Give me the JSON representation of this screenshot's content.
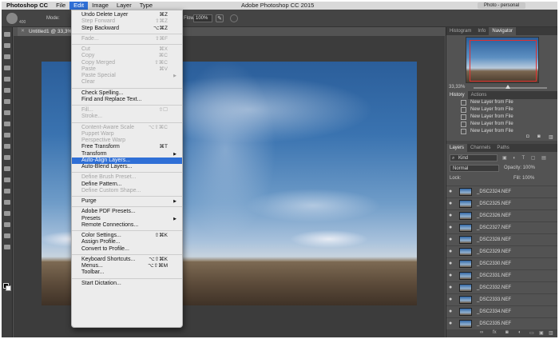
{
  "menubar": {
    "app_name": "Photoshop CC",
    "menus": [
      "File",
      "Edit",
      "Image",
      "Layer",
      "Type"
    ],
    "window_title": "Adobe Photoshop CC 2015",
    "workspace": "Photo - personal"
  },
  "options": {
    "brush_size": "400",
    "mode_label": "Mode:",
    "flow_label": "Flow:",
    "flow_value": "100%"
  },
  "document": {
    "tab_title": "Untitled1 @ 33,3% (RGB/8) *"
  },
  "edit_menu": {
    "items": [
      {
        "label": "Undo Delete Layer",
        "shortcut": "⌘Z",
        "disabled": false
      },
      {
        "label": "Step Forward",
        "shortcut": "⇧⌘Z",
        "disabled": true
      },
      {
        "label": "Step Backward",
        "shortcut": "⌥⌘Z",
        "disabled": false
      },
      {
        "sep": true
      },
      {
        "label": "Fade...",
        "shortcut": "⇧⌘F",
        "disabled": true
      },
      {
        "sep": true
      },
      {
        "label": "Cut",
        "shortcut": "⌘X",
        "disabled": true
      },
      {
        "label": "Copy",
        "shortcut": "⌘C",
        "disabled": true
      },
      {
        "label": "Copy Merged",
        "shortcut": "⇧⌘C",
        "disabled": true
      },
      {
        "label": "Paste",
        "shortcut": "⌘V",
        "disabled": true
      },
      {
        "label": "Paste Special",
        "arrow": true,
        "disabled": true
      },
      {
        "label": "Clear",
        "disabled": true
      },
      {
        "sep": true
      },
      {
        "label": "Check Spelling...",
        "disabled": false
      },
      {
        "label": "Find and Replace Text...",
        "disabled": false
      },
      {
        "sep": true
      },
      {
        "label": "Fill...",
        "shortcut": "⇧☐",
        "disabled": true
      },
      {
        "label": "Stroke...",
        "disabled": true
      },
      {
        "sep": true
      },
      {
        "label": "Content-Aware Scale",
        "shortcut": "⌥⇧⌘C",
        "disabled": true
      },
      {
        "label": "Puppet Warp",
        "disabled": true
      },
      {
        "label": "Perspective Warp",
        "disabled": true
      },
      {
        "label": "Free Transform",
        "shortcut": "⌘T",
        "disabled": false
      },
      {
        "label": "Transform",
        "arrow": true,
        "disabled": false
      },
      {
        "label": "Auto-Align Layers...",
        "disabled": false,
        "highlighted": true
      },
      {
        "label": "Auto-Blend Layers...",
        "disabled": false
      },
      {
        "sep": true
      },
      {
        "label": "Define Brush Preset...",
        "disabled": true
      },
      {
        "label": "Define Pattern...",
        "disabled": false
      },
      {
        "label": "Define Custom Shape...",
        "disabled": true
      },
      {
        "sep": true
      },
      {
        "label": "Purge",
        "arrow": true,
        "disabled": false
      },
      {
        "sep": true
      },
      {
        "label": "Adobe PDF Presets...",
        "disabled": false
      },
      {
        "label": "Presets",
        "arrow": true,
        "disabled": false
      },
      {
        "label": "Remote Connections...",
        "disabled": false
      },
      {
        "sep": true
      },
      {
        "label": "Color Settings...",
        "shortcut": "⇧⌘K",
        "disabled": false
      },
      {
        "label": "Assign Profile...",
        "disabled": false
      },
      {
        "label": "Convert to Profile...",
        "disabled": false
      },
      {
        "sep": true
      },
      {
        "label": "Keyboard Shortcuts...",
        "shortcut": "⌥⇧⌘K",
        "disabled": false
      },
      {
        "label": "Menus...",
        "shortcut": "⌥⇧⌘M",
        "disabled": false
      },
      {
        "label": "Toolbar...",
        "disabled": false
      },
      {
        "sep": true
      },
      {
        "label": "Start Dictation...",
        "disabled": false
      }
    ]
  },
  "navigator": {
    "tabs": [
      "Histogram",
      "Info",
      "Navigator"
    ],
    "zoom": "33,33%"
  },
  "history": {
    "tabs": [
      "History",
      "Actions"
    ],
    "items": [
      "New Layer from File",
      "New Layer from File",
      "New Layer from File",
      "New Layer from File",
      "New Layer from File"
    ]
  },
  "layers": {
    "tabs": [
      "Layers",
      "Channels",
      "Paths"
    ],
    "kind": "Kind",
    "blend_mode": "Normal",
    "opacity_label": "Opacity: 100%",
    "lock_label": "Lock:",
    "fill_label": "Fill: 100%",
    "items": [
      "_DSC2324.NEF",
      "_DSC2325.NEF",
      "_DSC2326.NEF",
      "_DSC2327.NEF",
      "_DSC2328.NEF",
      "_DSC2329.NEF",
      "_DSC2330.NEF",
      "_DSC2331.NEF",
      "_DSC2332.NEF",
      "_DSC2333.NEF",
      "_DSC2334.NEF",
      "_DSC2335.NEF"
    ]
  }
}
